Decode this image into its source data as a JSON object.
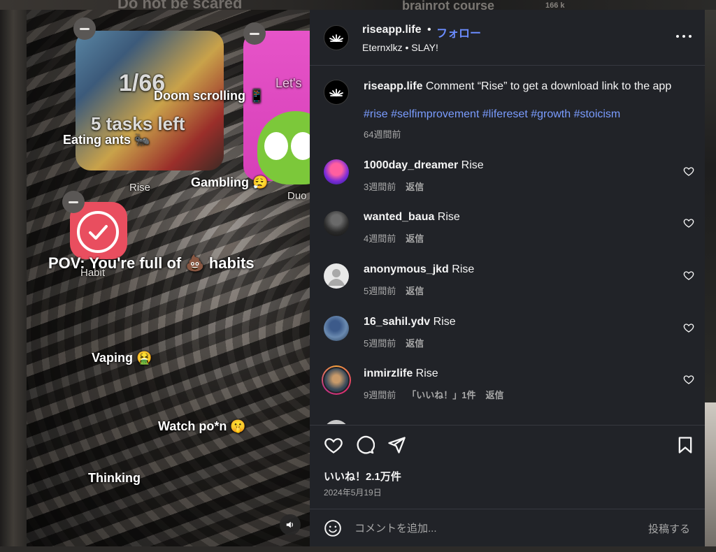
{
  "background": {
    "text_1": "Do not be scared",
    "text_2": "brainrot course",
    "text_3": "166 k"
  },
  "video": {
    "card_rise_label": "Rise",
    "card_duo_label": "Duo",
    "card_duo_text": "Let's",
    "card_habit_label": "Habit",
    "counter_text": "1/66",
    "tasks_text": "5 tasks left",
    "overlay_texts": {
      "doom": "Doom scrolling 📱",
      "eating": "Eating ants 🐜",
      "gambling": "Gambling 😮‍💨",
      "pov": "POV: You're full of 💩 habits",
      "vaping": "Vaping 🤮",
      "watch": "Watch po*n 🤫",
      "thinking": "Thinking"
    },
    "mute_icon": "speaker-icon"
  },
  "header": {
    "username": "riseapp.life",
    "dot": "•",
    "follow_label": "フォロー",
    "subtitle": "Eternxlkz • SLAY!",
    "more_icon": "more-horizontal-icon"
  },
  "caption": {
    "username": "riseapp.life",
    "text": " Comment “Rise” to get a download link to the app",
    "hashtags": "#rise #selfimprovement #lifereset #growth #stoicism",
    "time": "64週間前"
  },
  "comments": [
    {
      "username": "1000day_dreamer",
      "text": " Rise",
      "time": "3週間前",
      "reply": "返信",
      "likes": ""
    },
    {
      "username": "wanted_baua",
      "text": " Rise",
      "time": "4週間前",
      "reply": "返信",
      "likes": ""
    },
    {
      "username": "anonymous_jkd",
      "text": " Rise",
      "time": "5週間前",
      "reply": "返信",
      "likes": ""
    },
    {
      "username": "16_sahil.ydv",
      "text": " Rise",
      "time": "5週間前",
      "reply": "返信",
      "likes": ""
    },
    {
      "username": "inmirzlife",
      "text": " Rise",
      "time": "9週間前",
      "reply": "返信",
      "likes": "「いいね！」1件"
    }
  ],
  "actions": {
    "like_icon": "heart-icon",
    "comment_icon": "comment-icon",
    "share_icon": "send-icon",
    "save_icon": "bookmark-icon",
    "likes_count": "いいね！2.1万件",
    "date": "2024年5月19日"
  },
  "add_comment": {
    "placeholder": "コメントを追加...",
    "post_label": "投稿する",
    "emoji_icon": "smiley-icon"
  },
  "colors": {
    "panel_bg": "#212328",
    "link_blue": "#6b8cff",
    "hashtag_blue": "#7a9cff",
    "muted_text": "#a8a8a8"
  }
}
